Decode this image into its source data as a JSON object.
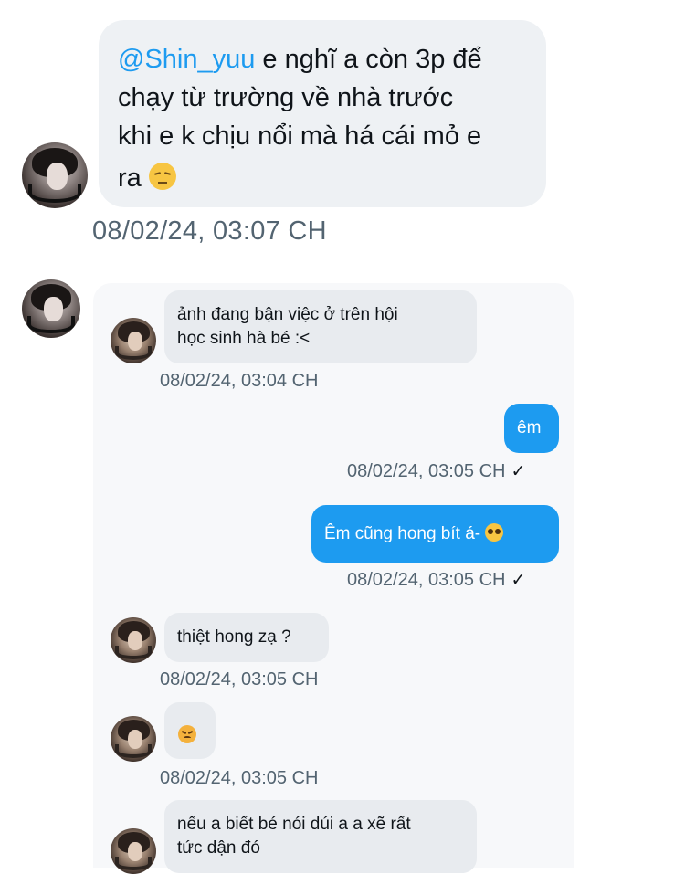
{
  "post": {
    "mention": "@Shin_yuu",
    "text_line1": " e nghĩ a còn 3p để",
    "text_line2": "chạy từ trường về nhà trước",
    "text_line3": "khi e k chịu nổi mà há cái mỏ e",
    "text_line4": "ra ",
    "emoji": "pensive-face-emoji",
    "timestamp": "08/02/24, 03:07 CH"
  },
  "embedded_chat": {
    "messages": [
      {
        "side": "left",
        "lines": [
          "ảnh đang bận việc ở trên hội",
          "học sinh hà bé :<"
        ],
        "time": "08/02/24, 03:04 CH"
      },
      {
        "side": "right",
        "lines": [
          "êm"
        ],
        "time": "08/02/24, 03:05 CH",
        "status": "✓"
      },
      {
        "side": "right",
        "lines": [
          "Êm cũng hong bít á- "
        ],
        "emoji": "pleading-face-emoji",
        "time": "08/02/24, 03:05 CH",
        "status": "✓"
      },
      {
        "side": "left",
        "lines": [
          "thiệt hong zạ ?"
        ],
        "time": "08/02/24, 03:05 CH"
      },
      {
        "side": "left",
        "lines": [
          ""
        ],
        "emoji": "angry-face-emoji",
        "time": "08/02/24, 03:05 CH"
      },
      {
        "side": "left",
        "lines": [
          "nếu a biết bé nói dúi a a xẽ rất",
          "tức dận đó"
        ]
      }
    ]
  },
  "colors": {
    "accent": "#1d9bf0",
    "bubble_gray": "#eef1f4",
    "meta_text": "#536471"
  }
}
